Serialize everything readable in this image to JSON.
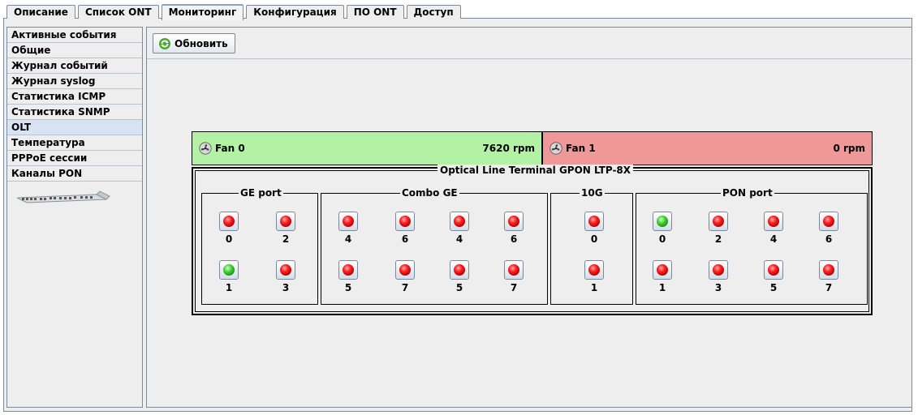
{
  "tabs": [
    {
      "label": "Описание",
      "active": false
    },
    {
      "label": "Список ONT",
      "active": false
    },
    {
      "label": "Мониторинг",
      "active": true
    },
    {
      "label": "Конфигурация",
      "active": false
    },
    {
      "label": "ПО ONT",
      "active": false
    },
    {
      "label": "Доступ",
      "active": false
    }
  ],
  "sidebar": {
    "items": [
      {
        "label": "Активные события",
        "active": false
      },
      {
        "label": "Общие",
        "active": false
      },
      {
        "label": "Журнал событий",
        "active": false
      },
      {
        "label": "Журнал syslog",
        "active": false
      },
      {
        "label": "Статистика ICMP",
        "active": false
      },
      {
        "label": "Статистика SNMP",
        "active": false
      },
      {
        "label": "OLT",
        "active": true
      },
      {
        "label": "Температура",
        "active": false
      },
      {
        "label": "PPPoE сессии",
        "active": false
      },
      {
        "label": "Каналы PON",
        "active": false
      }
    ]
  },
  "toolbar": {
    "refresh_label": "Обновить"
  },
  "fans": [
    {
      "name": "Fan 0",
      "rpm": "7620 rpm",
      "status": "ok",
      "color": "#b3f2a4"
    },
    {
      "name": "Fan 1",
      "rpm": "0 rpm",
      "status": "fail",
      "color": "#f09798"
    }
  ],
  "olt": {
    "title": "Optical Line Terminal GPON LTP-8X",
    "groups": [
      {
        "title": "GE port",
        "ports": [
          {
            "num": "0",
            "state": "red"
          },
          {
            "num": "2",
            "state": "red"
          },
          {
            "num": "1",
            "state": "green"
          },
          {
            "num": "3",
            "state": "red"
          }
        ]
      },
      {
        "title": "Combo GE",
        "ports": [
          {
            "num": "4",
            "state": "red"
          },
          {
            "num": "6",
            "state": "red"
          },
          {
            "num": "4",
            "state": "red"
          },
          {
            "num": "6",
            "state": "red"
          },
          {
            "num": "5",
            "state": "red"
          },
          {
            "num": "7",
            "state": "red"
          },
          {
            "num": "5",
            "state": "red"
          },
          {
            "num": "7",
            "state": "red"
          }
        ]
      },
      {
        "title": "10G",
        "ports": [
          {
            "num": "0",
            "state": "red"
          },
          {
            "num": "1",
            "state": "red"
          }
        ]
      },
      {
        "title": "PON port",
        "ports": [
          {
            "num": "0",
            "state": "green"
          },
          {
            "num": "2",
            "state": "red"
          },
          {
            "num": "4",
            "state": "red"
          },
          {
            "num": "6",
            "state": "red"
          },
          {
            "num": "1",
            "state": "red"
          },
          {
            "num": "3",
            "state": "red"
          },
          {
            "num": "5",
            "state": "red"
          },
          {
            "num": "7",
            "state": "red"
          }
        ]
      }
    ]
  }
}
